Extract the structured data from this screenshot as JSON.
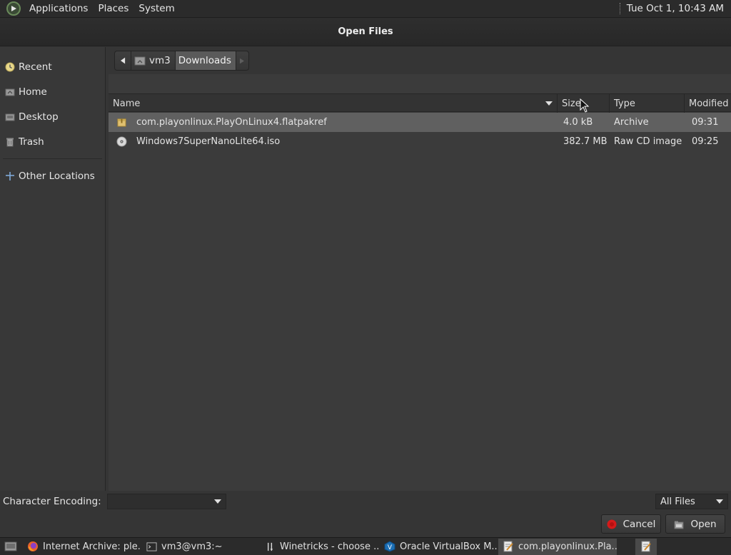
{
  "top_panel": {
    "menus": [
      "Applications",
      "Places",
      "System"
    ],
    "clock": "Tue Oct  1, 10:43 AM"
  },
  "dialog": {
    "title": "Open Files",
    "sidebar": {
      "items": [
        {
          "label": "Recent",
          "icon": "recent-icon"
        },
        {
          "label": "Home",
          "icon": "home-icon"
        },
        {
          "label": "Desktop",
          "icon": "desktop-icon"
        },
        {
          "label": "Trash",
          "icon": "trash-icon"
        }
      ],
      "other": {
        "label": "Other Locations",
        "icon": "plus-icon"
      }
    },
    "path": {
      "segments": [
        "vm3",
        "Downloads"
      ],
      "active": "Downloads"
    },
    "columns": {
      "name": "Name",
      "size": "Size",
      "type": "Type",
      "modified": "Modified"
    },
    "files": [
      {
        "name": "com.playonlinux.PlayOnLinux4.flatpakref",
        "size": "4.0 kB",
        "type": "Archive",
        "modified": "09:31",
        "icon": "archive-icon",
        "selected": true
      },
      {
        "name": "Windows7SuperNanoLite64.iso",
        "size": "382.7 MB",
        "type": "Raw CD image",
        "modified": "09:25",
        "icon": "disc-icon",
        "selected": false
      }
    ],
    "encoding_label": "Character Encoding:",
    "encoding_value": "",
    "filter_value": "All Files",
    "buttons": {
      "cancel": "Cancel",
      "open": "Open"
    }
  },
  "taskbar": {
    "tasks": [
      {
        "label": "Internet Archive: ple...",
        "icon": "firefox-icon"
      },
      {
        "label": "vm3@vm3:~",
        "icon": "terminal-icon"
      },
      {
        "label": "Winetricks - choose ...",
        "icon": "winetricks-icon"
      },
      {
        "label": "Oracle VirtualBox M...",
        "icon": "virtualbox-icon"
      },
      {
        "label": "com.playonlinux.Pla...",
        "icon": "text-editor-icon",
        "active": true
      }
    ]
  },
  "colors": {
    "panel": "#2b2b2b",
    "dialog_bg": "#353535",
    "selection": "#606060",
    "cancel_red": "#d41a1a"
  }
}
